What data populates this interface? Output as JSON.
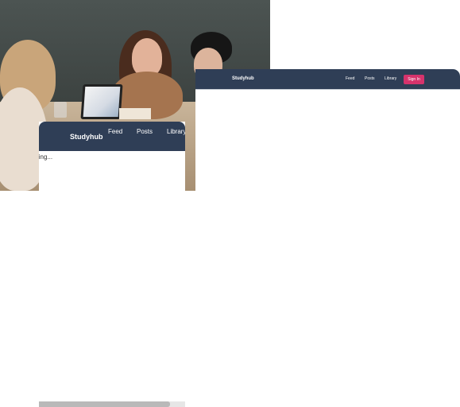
{
  "small_window": {
    "brand": "Studyhub",
    "nav": {
      "feed": "Feed",
      "posts": "Posts",
      "library": "Library"
    },
    "status_text": "ling..."
  },
  "large_window": {
    "brand": "Studyhub",
    "nav": {
      "feed": "Feed",
      "posts": "Posts",
      "library": "Library"
    },
    "sign_in": "Sign In"
  },
  "colors": {
    "navbar": "#2f3e56",
    "sign_in_button": "#d6336c",
    "page_background": "#ffffff"
  },
  "icons": {
    "photo": "students-working-photo"
  }
}
